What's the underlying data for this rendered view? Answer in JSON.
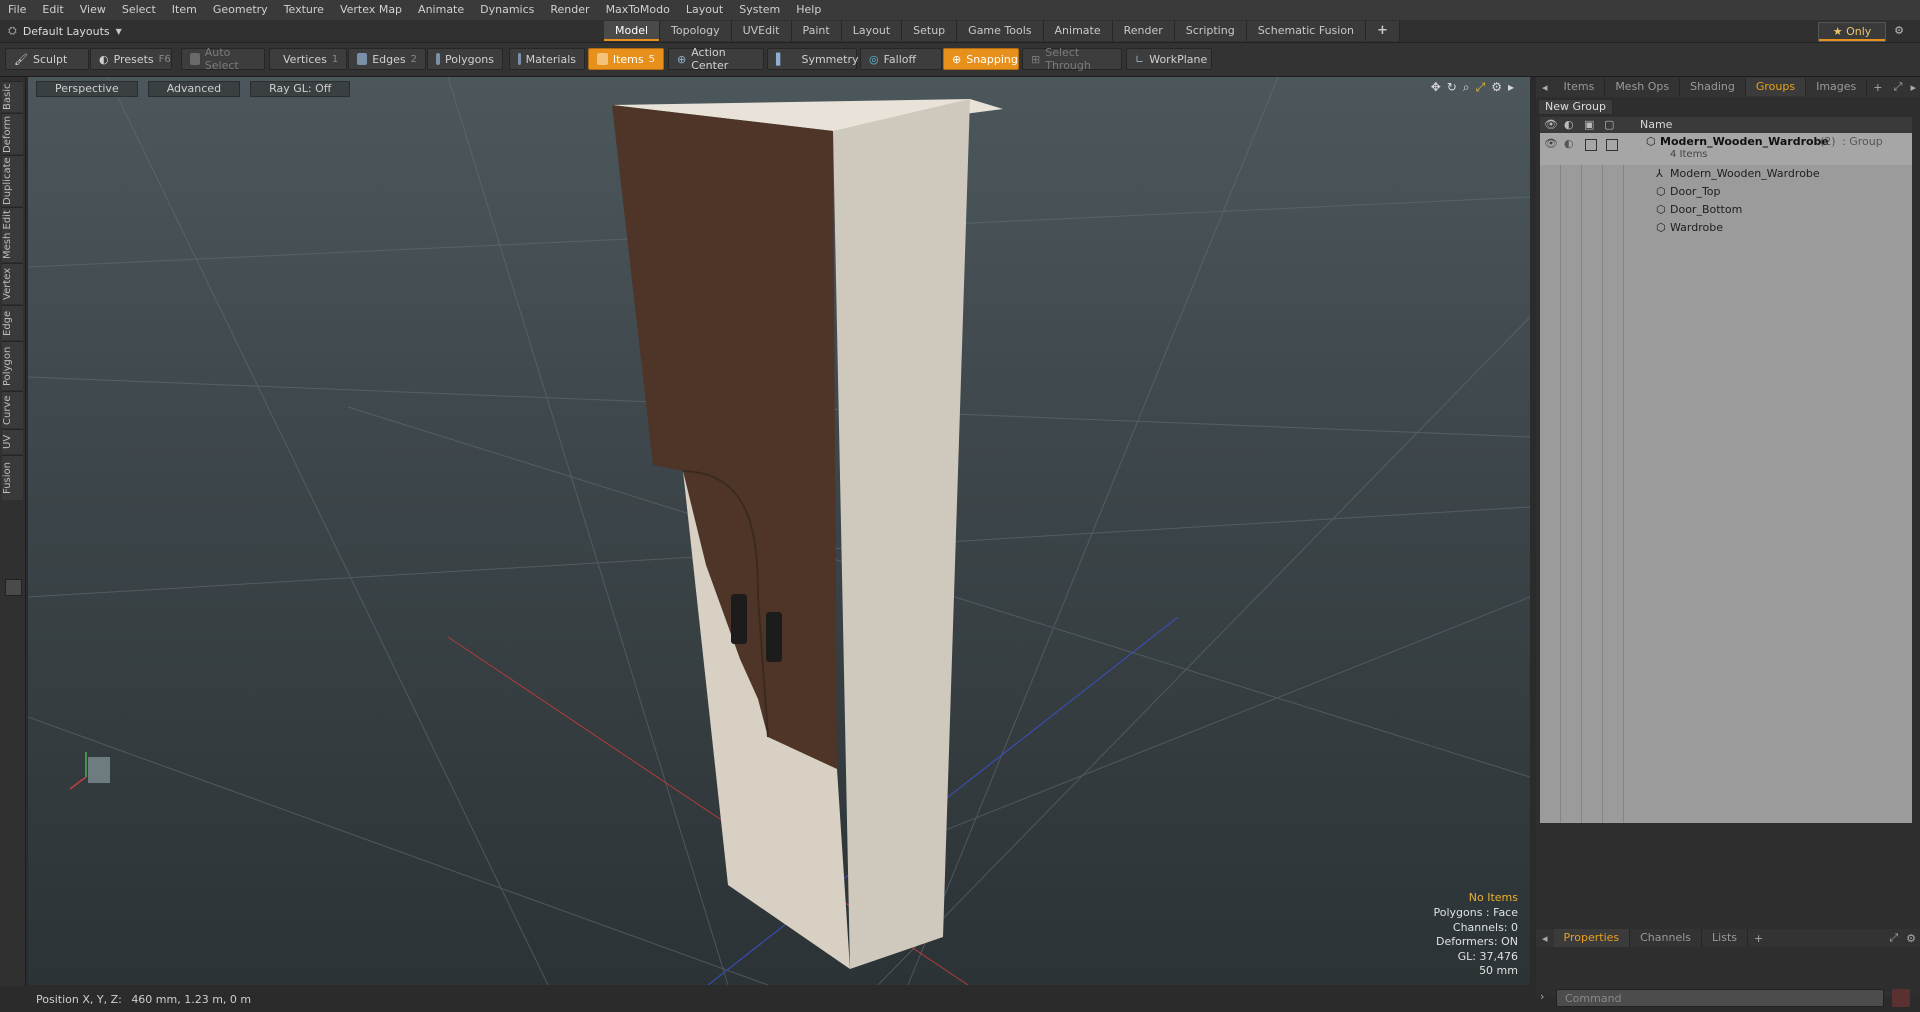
{
  "menu": [
    "File",
    "Edit",
    "View",
    "Select",
    "Item",
    "Geometry",
    "Texture",
    "Vertex Map",
    "Animate",
    "Dynamics",
    "Render",
    "MaxToModo",
    "Layout",
    "System",
    "Help"
  ],
  "layout_selector": "Default Layouts",
  "mode_tabs": [
    "Model",
    "Topology",
    "UVEdit",
    "Paint",
    "Layout",
    "Setup",
    "Game Tools",
    "Animate",
    "Render",
    "Scripting",
    "Schematic Fusion"
  ],
  "active_mode_tab": "Model",
  "only_label": "Only",
  "toolbar": {
    "sculpt": "Sculpt",
    "presets": "Presets",
    "presets_key": "F6",
    "auto_select": "Auto Select",
    "vertices": "Vertices",
    "vertices_num": "1",
    "edges": "Edges",
    "edges_num": "2",
    "polygons": "Polygons",
    "materials": "Materials",
    "items": "Items",
    "items_num": "5",
    "action_center": "Action Center",
    "symmetry": "Symmetry",
    "falloff": "Falloff",
    "snapping": "Snapping",
    "select_through": "Select Through",
    "workplane": "WorkPlane"
  },
  "left_tabs": [
    "Basic",
    "Deform",
    "Duplicate",
    "Mesh Edit",
    "Vertex",
    "Edge",
    "Polygon",
    "Curve",
    "UV",
    "Fusion"
  ],
  "viewport": {
    "view": "Perspective",
    "shading": "Advanced",
    "raygl": "Ray GL: Off"
  },
  "stats": {
    "no_items": "No Items",
    "polygons": "Polygons : Face",
    "channels": "Channels: 0",
    "deformers": "Deformers: ON",
    "gl": "GL: 37,476",
    "unit": "50 mm"
  },
  "status_bar": {
    "label": "Position X, Y, Z:",
    "value": "460 mm, 1.23 m, 0 m"
  },
  "right_panel": {
    "tabs": [
      "Items",
      "Mesh Ops",
      "Shading",
      "Groups",
      "Images"
    ],
    "active_tab": "Groups",
    "new_group": "New Group",
    "name_header": "Name",
    "group": {
      "name": "Modern_Wooden_Wardrobe",
      "count": "(2)",
      "type": ": Group",
      "items_count": "4 Items"
    },
    "children": [
      "Modern_Wooden_Wardrobe",
      "Door_Top",
      "Door_Bottom",
      "Wardrobe"
    ],
    "bottom_tabs": [
      "Properties",
      "Channels",
      "Lists"
    ],
    "active_bottom_tab": "Properties",
    "command_placeholder": "Command"
  },
  "colors": {
    "accent": "#e8901c",
    "dark_wood": "#4e3528",
    "light_wood": "#d8d0c6"
  }
}
